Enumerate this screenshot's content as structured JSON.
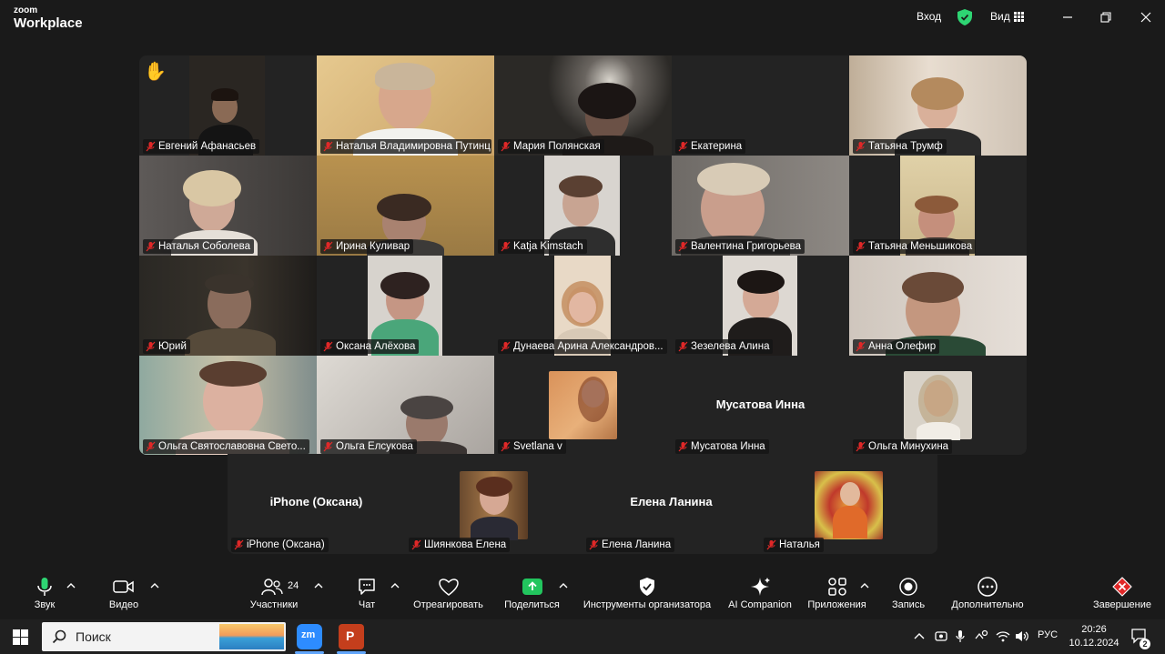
{
  "app": {
    "brand_line1": "zoom",
    "brand_line2": "Workplace"
  },
  "titlebar": {
    "signin": "Вход",
    "view": "Вид"
  },
  "participants": [
    {
      "name": "Евгений Афанасьев",
      "hand_raised": true
    },
    {
      "name": "Наталья Владимировна Путинц...",
      "active_speaker": true
    },
    {
      "name": "Мария Полянская"
    },
    {
      "name": "Екатерина"
    },
    {
      "name": "Татьяна Трумф"
    },
    {
      "name": "Наталья Соболева"
    },
    {
      "name": "Ирина Куливар"
    },
    {
      "name": "Katja Kimstach"
    },
    {
      "name": "Валентина Григорьева"
    },
    {
      "name": "Татьяна Меньшикова"
    },
    {
      "name": "Юрий"
    },
    {
      "name": "Оксана Алёхова"
    },
    {
      "name": "Дунаева Арина Александров..."
    },
    {
      "name": "Зезелева Алина"
    },
    {
      "name": "Анна Олефир"
    },
    {
      "name": "Ольга Святославовна Свето..."
    },
    {
      "name": "Ольга Елсукова"
    },
    {
      "name": "Svetlana v"
    },
    {
      "name": "Мусатова Инна",
      "display_name": "Мусатова Инна"
    },
    {
      "name": "Ольга Минухина"
    },
    {
      "name": "iPhone (Оксана)",
      "display_name": "iPhone (Оксана)"
    },
    {
      "name": "Шиянкова Елена"
    },
    {
      "name": "Елена Ланина",
      "display_name": "Елена Ланина"
    },
    {
      "name": "Наталья"
    }
  ],
  "toolbar": {
    "audio": "Звук",
    "video": "Видео",
    "participants": "Участники",
    "participants_count": "24",
    "chat": "Чат",
    "react": "Отреагировать",
    "share": "Поделиться",
    "host_tools": "Инструменты организатора",
    "ai": "AI Companion",
    "apps": "Приложения",
    "record": "Запись",
    "more": "Дополнительно",
    "end": "Завершение"
  },
  "taskbar": {
    "search_placeholder": "Поиск",
    "language": "РУС",
    "time": "20:26",
    "date": "10.12.2024",
    "notifications": "2"
  },
  "colors": {
    "active_speaker": "#2ed573",
    "muted_mic": "#e02828",
    "end": "#e02828",
    "share": "#22c55e"
  }
}
